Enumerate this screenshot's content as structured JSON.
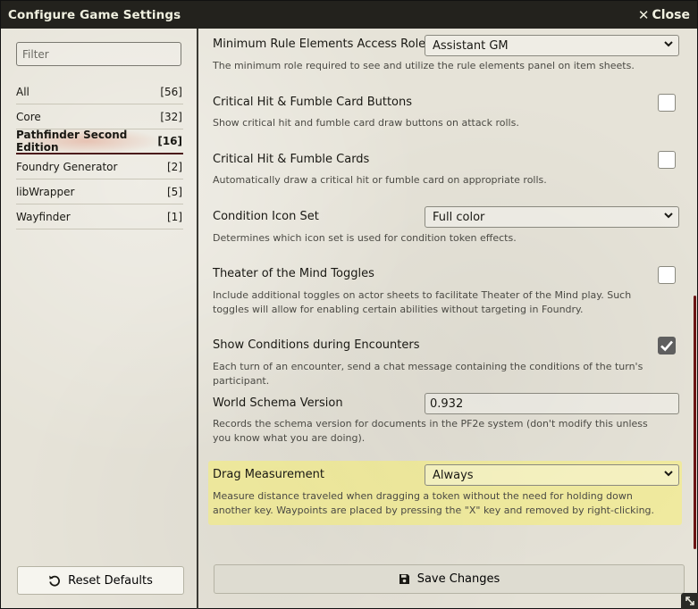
{
  "window": {
    "title": "Configure Game Settings",
    "close_label": "Close"
  },
  "sidebar": {
    "filter_placeholder": "Filter",
    "categories": [
      {
        "label": "All",
        "count": "[56]"
      },
      {
        "label": "Core",
        "count": "[32]"
      },
      {
        "label": "Pathfinder Second Edition",
        "count": "[16]",
        "active": true
      },
      {
        "label": "Foundry Generator",
        "count": "[2]"
      },
      {
        "label": "libWrapper",
        "count": "[5]"
      },
      {
        "label": "Wayfinder",
        "count": "[1]"
      }
    ],
    "reset_label": "Reset Defaults"
  },
  "settings": {
    "rule_elements": {
      "label": "Minimum Rule Elements Access Role",
      "value": "Assistant GM",
      "hint": "The minimum role required to see and utilize the rule elements panel on item sheets."
    },
    "crit_buttons": {
      "label": "Critical Hit & Fumble Card Buttons",
      "checked": false,
      "hint": "Show critical hit and fumble card draw buttons on attack rolls."
    },
    "crit_cards": {
      "label": "Critical Hit & Fumble Cards",
      "checked": false,
      "hint": "Automatically draw a critical hit or fumble card on appropriate rolls."
    },
    "condition_icons": {
      "label": "Condition Icon Set",
      "value": "Full color",
      "hint": "Determines which icon set is used for condition token effects."
    },
    "theater": {
      "label": "Theater of the Mind Toggles",
      "checked": false,
      "hint": "Include additional toggles on actor sheets to facilitate Theater of the Mind play. Such toggles will allow for enabling certain abilities without targeting in Foundry."
    },
    "show_conditions": {
      "label": "Show Conditions during Encounters",
      "checked": true,
      "hint": "Each turn of an encounter, send a chat message containing the conditions of the turn's participant."
    },
    "schema": {
      "label": "World Schema Version",
      "value": "0.932",
      "hint": "Records the schema version for documents in the PF2e system (don't modify this unless you know what you are doing)."
    },
    "drag_measurement": {
      "label": "Drag Measurement",
      "value": "Always",
      "hint": "Measure distance traveled when dragging a token without the need for holding down another key. Waypoints are placed by pressing the \"X\" key and removed by right-clicking."
    }
  },
  "footer": {
    "save_label": "Save Changes"
  },
  "colors": {
    "titlebar": "#23221d",
    "highlight": "#fff650",
    "accent": "#6b1414"
  }
}
